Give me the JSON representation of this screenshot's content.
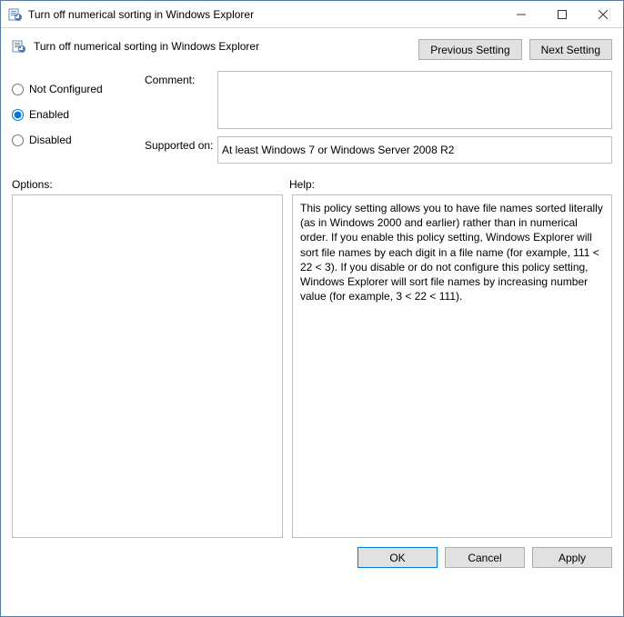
{
  "window": {
    "title": "Turn off numerical sorting in Windows Explorer"
  },
  "header": {
    "policy_title": "Turn off numerical sorting in Windows Explorer",
    "prev_label": "Previous Setting",
    "next_label": "Next Setting"
  },
  "radios": {
    "not_configured": "Not Configured",
    "enabled": "Enabled",
    "disabled": "Disabled",
    "selected": "enabled"
  },
  "fields": {
    "comment_label": "Comment:",
    "comment_value": "",
    "supported_label": "Supported on:",
    "supported_value": "At least Windows 7 or Windows Server 2008 R2"
  },
  "sections": {
    "options_label": "Options:",
    "help_label": "Help:"
  },
  "help_text": "This policy setting allows you to have file names sorted literally (as in Windows 2000 and earlier) rather than in numerical order. If you enable this policy setting, Windows Explorer will sort file names by each digit in a file name (for example, 111 < 22 < 3). If you disable or do not configure this policy setting, Windows Explorer will sort file names by increasing number value (for example, 3 < 22 < 111).",
  "footer": {
    "ok": "OK",
    "cancel": "Cancel",
    "apply": "Apply"
  }
}
